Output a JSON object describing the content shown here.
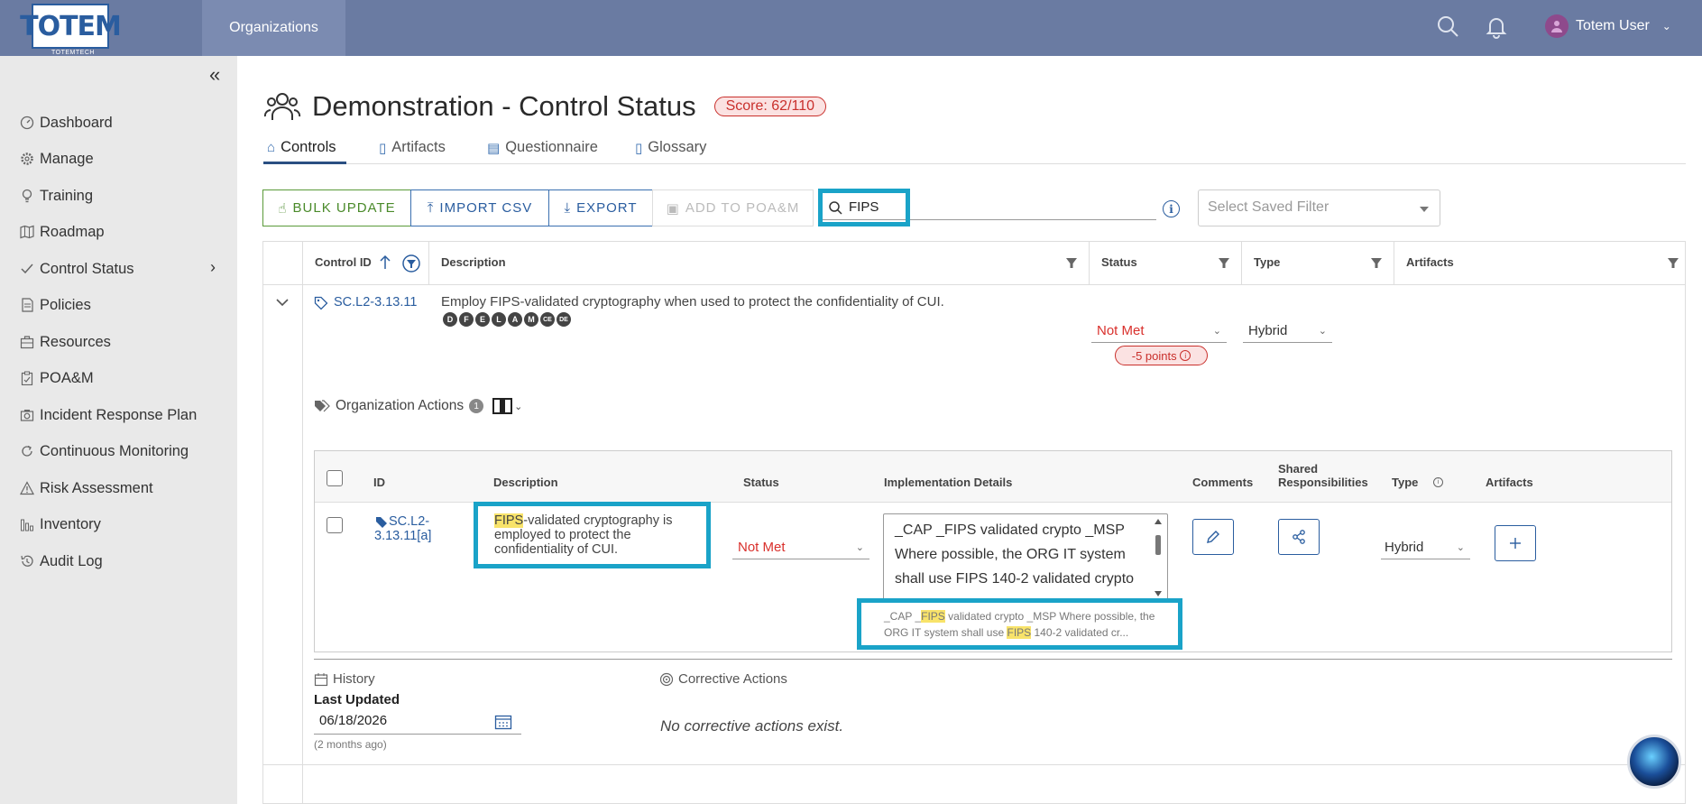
{
  "topbar": {
    "logo_text": "TOTEM",
    "logo_sub": "TOTEMTECH",
    "nav_org": "Organizations",
    "user_name": "Totem User",
    "icons": [
      "search-icon",
      "bell-icon",
      "user-avatar",
      "chevron-down-icon"
    ]
  },
  "sidebar": {
    "items": [
      {
        "label": "Dashboard",
        "icon": "dashboard-icon"
      },
      {
        "label": "Manage",
        "icon": "gear-icon"
      },
      {
        "label": "Training",
        "icon": "lightbulb-icon"
      },
      {
        "label": "Roadmap",
        "icon": "map-icon"
      },
      {
        "label": "Control Status",
        "icon": "check-icon"
      },
      {
        "label": "Policies",
        "icon": "document-icon"
      },
      {
        "label": "Resources",
        "icon": "briefcase-icon"
      },
      {
        "label": "POA&M",
        "icon": "clipboard-icon"
      },
      {
        "label": "Incident Response Plan",
        "icon": "camera-icon"
      },
      {
        "label": "Continuous Monitoring",
        "icon": "refresh-icon"
      },
      {
        "label": "Risk Assessment",
        "icon": "warning-icon"
      },
      {
        "label": "Inventory",
        "icon": "bar-chart-icon"
      },
      {
        "label": "Audit Log",
        "icon": "history-icon"
      }
    ]
  },
  "header": {
    "title": "Demonstration - Control Status",
    "score": "Score: 62/110"
  },
  "tabs": [
    {
      "label": "Controls",
      "active": true
    },
    {
      "label": "Artifacts"
    },
    {
      "label": "Questionnaire"
    },
    {
      "label": "Glossary"
    }
  ],
  "toolbar": {
    "bulk_update": "BULK UPDATE",
    "import_csv": "IMPORT CSV",
    "export": "EXPORT",
    "add_poam": "ADD TO POA&M",
    "search_value": "FIPS",
    "saved_filter_placeholder": "Select Saved Filter"
  },
  "grid": {
    "columns": [
      "Control ID",
      "Description",
      "Status",
      "Type",
      "Artifacts"
    ],
    "row": {
      "control_id": "SC.L2-3.13.11",
      "description": "Employ FIPS-validated cryptography when used to protect the confidentiality of CUI.",
      "tags": [
        "D",
        "F",
        "E",
        "L",
        "A",
        "M",
        "CE",
        "DE"
      ],
      "status": "Not Met",
      "points": "-5 points",
      "type": "Hybrid"
    }
  },
  "org_actions": {
    "label": "Organization Actions",
    "count": "1",
    "columns": [
      "ID",
      "Description",
      "Status",
      "Implementation Details",
      "Comments",
      "Shared Responsibilities",
      "Type",
      "Artifacts"
    ],
    "row": {
      "id": "SC.L2-3.13.11[a]",
      "description_hl": "FIPS",
      "description_rest": "-validated cryptography is employed to protect the confidentiality of CUI.",
      "status": "Not Met",
      "impl_text": "_CAP _FIPS validated crypto _MSP Where possible, the ORG IT system shall use FIPS 140-2 validated crypto",
      "snippet_1": "_CAP _",
      "snippet_hl1": "FIPS",
      "snippet_2": " validated crypto _MSP Where possible, the ORG IT system shall use ",
      "snippet_hl2": "FIPS",
      "snippet_3": " 140-2 validated cr...",
      "type": "Hybrid"
    }
  },
  "history": {
    "label": "History",
    "last_updated_label": "Last Updated",
    "date": "06/18/2026",
    "ago": "(2 months ago)"
  },
  "corrective": {
    "label": "Corrective Actions",
    "empty": "No corrective actions exist."
  },
  "colors": {
    "topbar": "#6a7ba2",
    "accent": "#2a5d9f",
    "danger": "#c9302c",
    "highlight_box": "#1aa3c8",
    "search_highlight": "#f8e36a"
  }
}
